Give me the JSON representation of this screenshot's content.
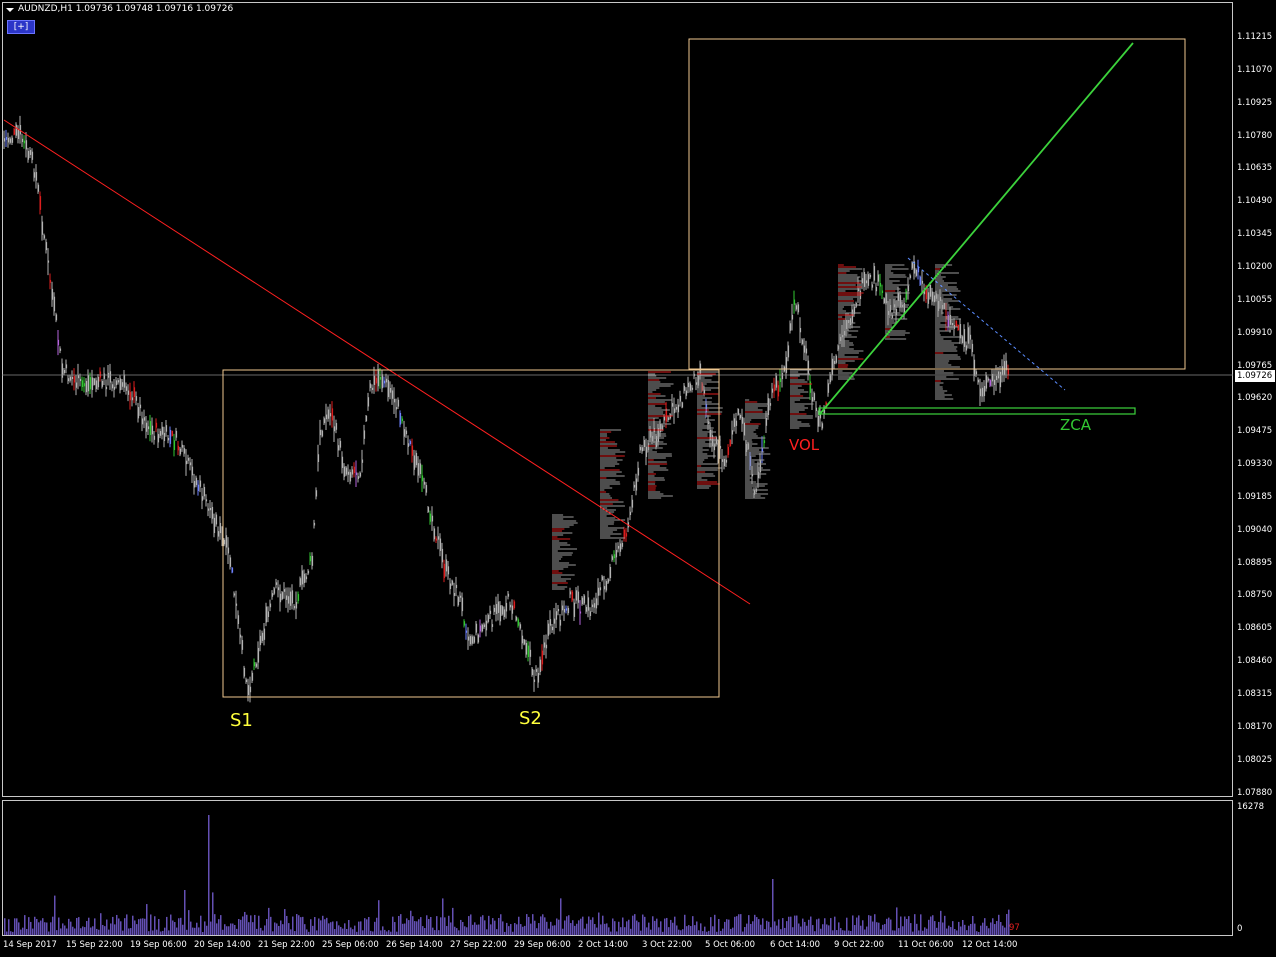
{
  "chart_header": {
    "symbol_text": "AUDNZD,H1  1.09736 1.09748 1.09716 1.09726",
    "expand_button": "[+]"
  },
  "price_axis": {
    "labels": [
      "1.11215",
      "1.11070",
      "1.10925",
      "1.10780",
      "1.10635",
      "1.10490",
      "1.10345",
      "1.10200",
      "1.10055",
      "1.09910",
      "1.09765",
      "1.09620",
      "1.09475",
      "1.09330",
      "1.09185",
      "1.09040",
      "1.08895",
      "1.08750",
      "1.08605",
      "1.08460",
      "1.08315",
      "1.08170",
      "1.08025",
      "1.07880"
    ],
    "current_price": "1.09726"
  },
  "time_axis": {
    "labels": [
      "14 Sep 2017",
      "15 Sep 22:00",
      "19 Sep 06:00",
      "20 Sep 14:00",
      "21 Sep 22:00",
      "25 Sep 06:00",
      "26 Sep 14:00",
      "27 Sep 22:00",
      "29 Sep 06:00",
      "2 Oct 14:00",
      "3 Oct 22:00",
      "5 Oct 06:00",
      "6 Oct 14:00",
      "9 Oct 22:00",
      "11 Oct 06:00",
      "12 Oct 14:00"
    ]
  },
  "annotations": {
    "s1": "S1",
    "s2": "S2",
    "vol": "VOL",
    "zca": "ZCA"
  },
  "volume_panel": {
    "max_label": "16278",
    "zero_label": "0",
    "current_label": "97"
  },
  "colors": {
    "background": "#000000",
    "candle": "#b4b4b4",
    "bull_highlight": "#32c832",
    "bear_highlight": "#dc1e1e",
    "trendline": "#ff2020",
    "rect": "#f0c890",
    "green_line": "#3cd23c",
    "volume_bar": "#6450b4",
    "annotation_yellow": "#ffff3c",
    "annotation_red": "#ff2020",
    "annotation_green": "#32c832"
  }
}
